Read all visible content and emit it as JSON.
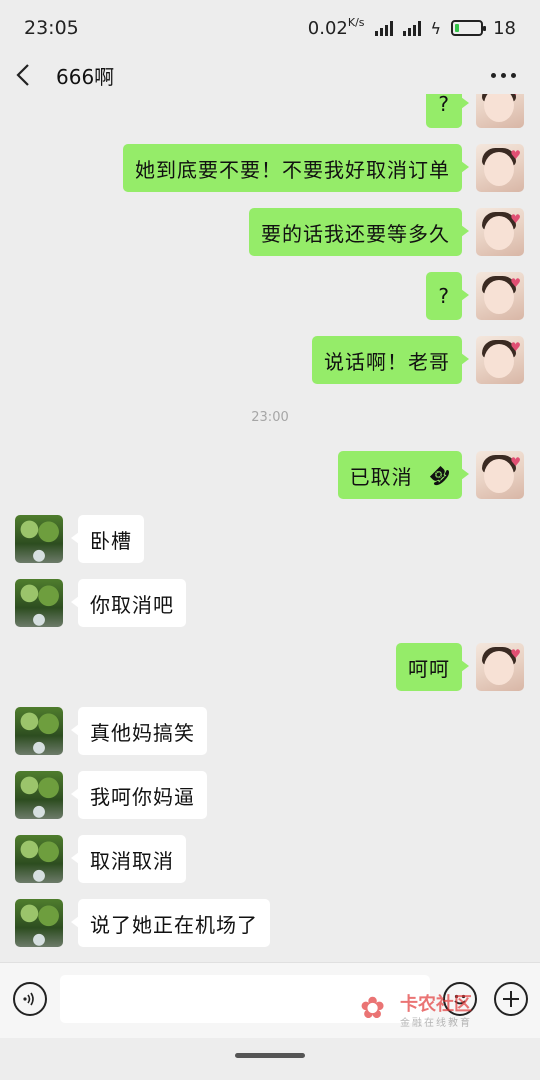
{
  "status_bar": {
    "time": "23:05",
    "network_speed": "0.02",
    "network_unit": "K/s",
    "battery_level": "18",
    "battery_fraction": 0.18
  },
  "header": {
    "title": "666啊"
  },
  "messages": [
    {
      "sender": "me",
      "text": "?"
    },
    {
      "sender": "me",
      "text": "她到底要不要！不要我好取消订单"
    },
    {
      "sender": "me",
      "text": "要的话我还要等多久"
    },
    {
      "sender": "me",
      "text": "?"
    },
    {
      "sender": "me",
      "text": "说话啊！老哥"
    },
    {
      "sender": "system",
      "text": "23:00"
    },
    {
      "sender": "me",
      "text": "已取消",
      "icon": "phone-hangup-icon"
    },
    {
      "sender": "them",
      "text": "卧槽"
    },
    {
      "sender": "them",
      "text": "你取消吧"
    },
    {
      "sender": "me",
      "text": "呵呵"
    },
    {
      "sender": "them",
      "text": "真他妈搞笑"
    },
    {
      "sender": "them",
      "text": "我呵你妈逼"
    },
    {
      "sender": "them",
      "text": "取消取消"
    },
    {
      "sender": "them",
      "text": "说了她正在机场了"
    }
  ],
  "input_bar": {
    "value": "",
    "placeholder": ""
  },
  "watermark": {
    "title": "卡农社区",
    "subtitle": "金融在线教育"
  },
  "colors": {
    "my_bubble": "#95ec69",
    "their_bubble": "#ffffff",
    "background": "#ededed"
  }
}
